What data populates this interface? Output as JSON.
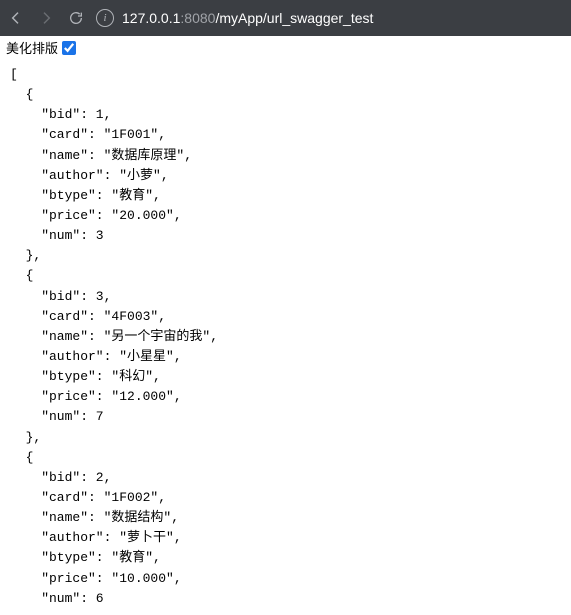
{
  "toolbar": {
    "url_host": "127.0.0.1",
    "url_port": ":8080",
    "url_path": "/myApp/url_swagger_test"
  },
  "prettybar": {
    "label": "美化排版",
    "checked": true
  },
  "json": {
    "records": [
      {
        "fields": [
          {
            "key": "\"bid\"",
            "value": "1",
            "quoted": false
          },
          {
            "key": "\"card\"",
            "value": "\"1F001\"",
            "quoted": true
          },
          {
            "key": "\"name\"",
            "value": "\"数据库原理\"",
            "quoted": true
          },
          {
            "key": "\"author\"",
            "value": "\"小萝\"",
            "quoted": true
          },
          {
            "key": "\"btype\"",
            "value": "\"教育\"",
            "quoted": true
          },
          {
            "key": "\"price\"",
            "value": "\"20.000\"",
            "quoted": true
          },
          {
            "key": "\"num\"",
            "value": "3",
            "quoted": false
          }
        ]
      },
      {
        "fields": [
          {
            "key": "\"bid\"",
            "value": "3",
            "quoted": false
          },
          {
            "key": "\"card\"",
            "value": "\"4F003\"",
            "quoted": true
          },
          {
            "key": "\"name\"",
            "value": "\"另一个宇宙的我\"",
            "quoted": true
          },
          {
            "key": "\"author\"",
            "value": "\"小星星\"",
            "quoted": true
          },
          {
            "key": "\"btype\"",
            "value": "\"科幻\"",
            "quoted": true
          },
          {
            "key": "\"price\"",
            "value": "\"12.000\"",
            "quoted": true
          },
          {
            "key": "\"num\"",
            "value": "7",
            "quoted": false
          }
        ]
      },
      {
        "fields": [
          {
            "key": "\"bid\"",
            "value": "2",
            "quoted": false
          },
          {
            "key": "\"card\"",
            "value": "\"1F002\"",
            "quoted": true
          },
          {
            "key": "\"name\"",
            "value": "\"数据结构\"",
            "quoted": true
          },
          {
            "key": "\"author\"",
            "value": "\"萝卜干\"",
            "quoted": true
          },
          {
            "key": "\"btype\"",
            "value": "\"教育\"",
            "quoted": true
          },
          {
            "key": "\"price\"",
            "value": "\"10.000\"",
            "quoted": true
          },
          {
            "key": "\"num\"",
            "value": "6",
            "quoted": false
          }
        ]
      }
    ]
  }
}
